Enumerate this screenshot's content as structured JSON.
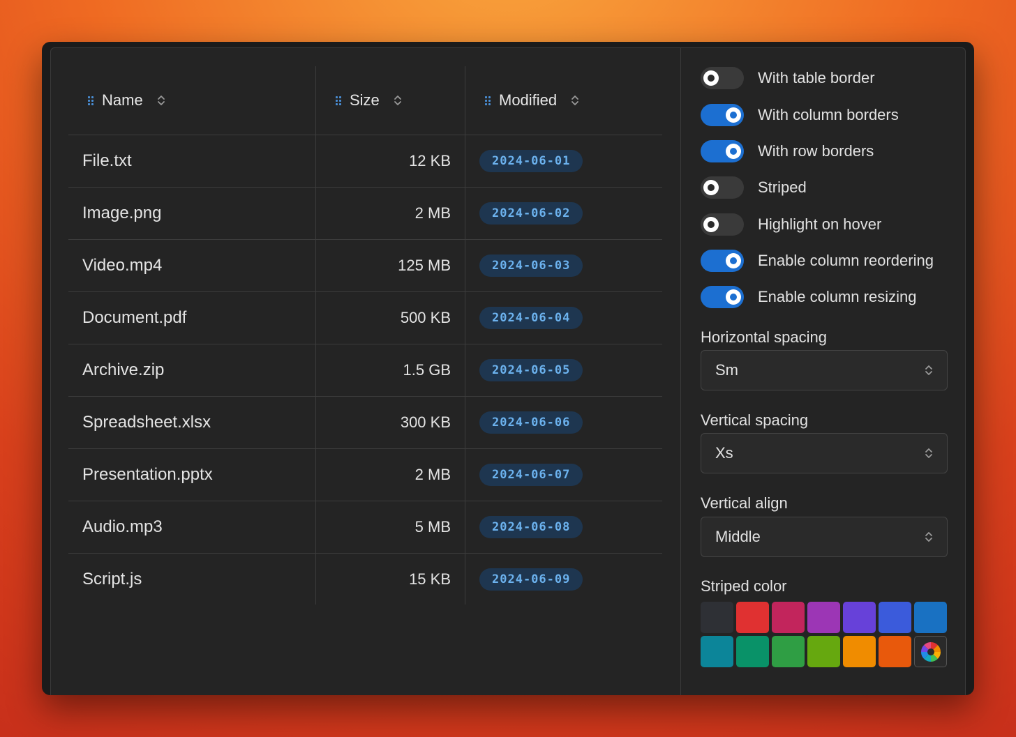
{
  "table": {
    "columns": [
      {
        "label": "Name"
      },
      {
        "label": "Size"
      },
      {
        "label": "Modified"
      }
    ],
    "rows": [
      {
        "name": "File.txt",
        "size": "12 KB",
        "modified": "2024-06-01"
      },
      {
        "name": "Image.png",
        "size": "2 MB",
        "modified": "2024-06-02"
      },
      {
        "name": "Video.mp4",
        "size": "125 MB",
        "modified": "2024-06-03"
      },
      {
        "name": "Document.pdf",
        "size": "500 KB",
        "modified": "2024-06-04"
      },
      {
        "name": "Archive.zip",
        "size": "1.5 GB",
        "modified": "2024-06-05"
      },
      {
        "name": "Spreadsheet.xlsx",
        "size": "300 KB",
        "modified": "2024-06-06"
      },
      {
        "name": "Presentation.pptx",
        "size": "2 MB",
        "modified": "2024-06-07"
      },
      {
        "name": "Audio.mp3",
        "size": "5 MB",
        "modified": "2024-06-08"
      },
      {
        "name": "Script.js",
        "size": "15 KB",
        "modified": "2024-06-09"
      }
    ]
  },
  "settings": {
    "toggles": [
      {
        "label": "With table border",
        "on": false
      },
      {
        "label": "With column borders",
        "on": true
      },
      {
        "label": "With row borders",
        "on": true
      },
      {
        "label": "Striped",
        "on": false
      },
      {
        "label": "Highlight on hover",
        "on": false
      },
      {
        "label": "Enable column reordering",
        "on": true
      },
      {
        "label": "Enable column resizing",
        "on": true
      }
    ],
    "horizontal_spacing": {
      "label": "Horizontal spacing",
      "value": "Sm"
    },
    "vertical_spacing": {
      "label": "Vertical spacing",
      "value": "Xs"
    },
    "vertical_align": {
      "label": "Vertical align",
      "value": "Middle"
    },
    "striped_color": {
      "label": "Striped color",
      "swatches": [
        "#2e3035",
        "#e03131",
        "#c2255c",
        "#9c36b5",
        "#6741d9",
        "#3b5bdb",
        "#1971c2",
        "#0c8599",
        "#099268",
        "#2f9e44",
        "#66a80f",
        "#f08c00",
        "#e8590c"
      ],
      "picker_icon": "color-wheel-icon"
    }
  },
  "colors": {
    "accent": "#1c6fd1",
    "badge_bg": "#1e3650",
    "badge_text": "#6cb2ee"
  }
}
